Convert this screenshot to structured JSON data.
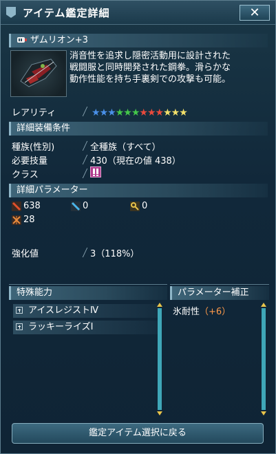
{
  "window": {
    "title": "アイテム鑑定詳細",
    "close_glyph": "✕"
  },
  "item": {
    "name": "ザムリオン+3",
    "description_lines": [
      "消音性を追求し隠密活動用に設計された",
      "戦闘服と同時開発された鋼拳。滑らかな",
      "動作性能を持ち手裏剣での攻撃も可能。"
    ],
    "rarity_label": "レアリティ",
    "rarity_stars": [
      {
        "color": "#4a90e8"
      },
      {
        "color": "#4a90e8"
      },
      {
        "color": "#4a90e8"
      },
      {
        "color": "#44c84a"
      },
      {
        "color": "#44c84a"
      },
      {
        "color": "#44c84a"
      },
      {
        "color": "#e84a3c"
      },
      {
        "color": "#e84a3c"
      },
      {
        "color": "#e84a3c"
      },
      {
        "color": "#f2e06a"
      },
      {
        "color": "#f2e06a"
      },
      {
        "color": "#f2e06a"
      }
    ]
  },
  "requirements": {
    "header": "詳細装備条件",
    "race_label": "種族(性別)",
    "race_value": "全種族（すべて）",
    "skill_label": "必要技量",
    "skill_value": "430（現在の値 438）",
    "class_label": "クラス"
  },
  "parameters": {
    "header": "詳細パラメーター",
    "stats": [
      {
        "icon": "striking-power-icon",
        "value": "638"
      },
      {
        "icon": "shooting-power-icon",
        "value": "0"
      },
      {
        "icon": "technique-power-icon",
        "value": "0"
      },
      {
        "icon": "dexterity-icon",
        "value": "28"
      }
    ],
    "enhance_label": "強化値",
    "enhance_value": "3（118%）"
  },
  "abilities": {
    "header": "特殊能力",
    "items": [
      "アイスレジストⅣ",
      "ラッキーライズⅠ"
    ]
  },
  "param_bonus": {
    "header": "パラメーター補正",
    "label": "氷耐性",
    "value": "（+6）"
  },
  "back_button": "鑑定アイテム選択に戻る",
  "colors": {
    "accent": "#8fb6c8",
    "bonus_value": "#ff9a4a",
    "class_badge": "#b03a8c"
  }
}
